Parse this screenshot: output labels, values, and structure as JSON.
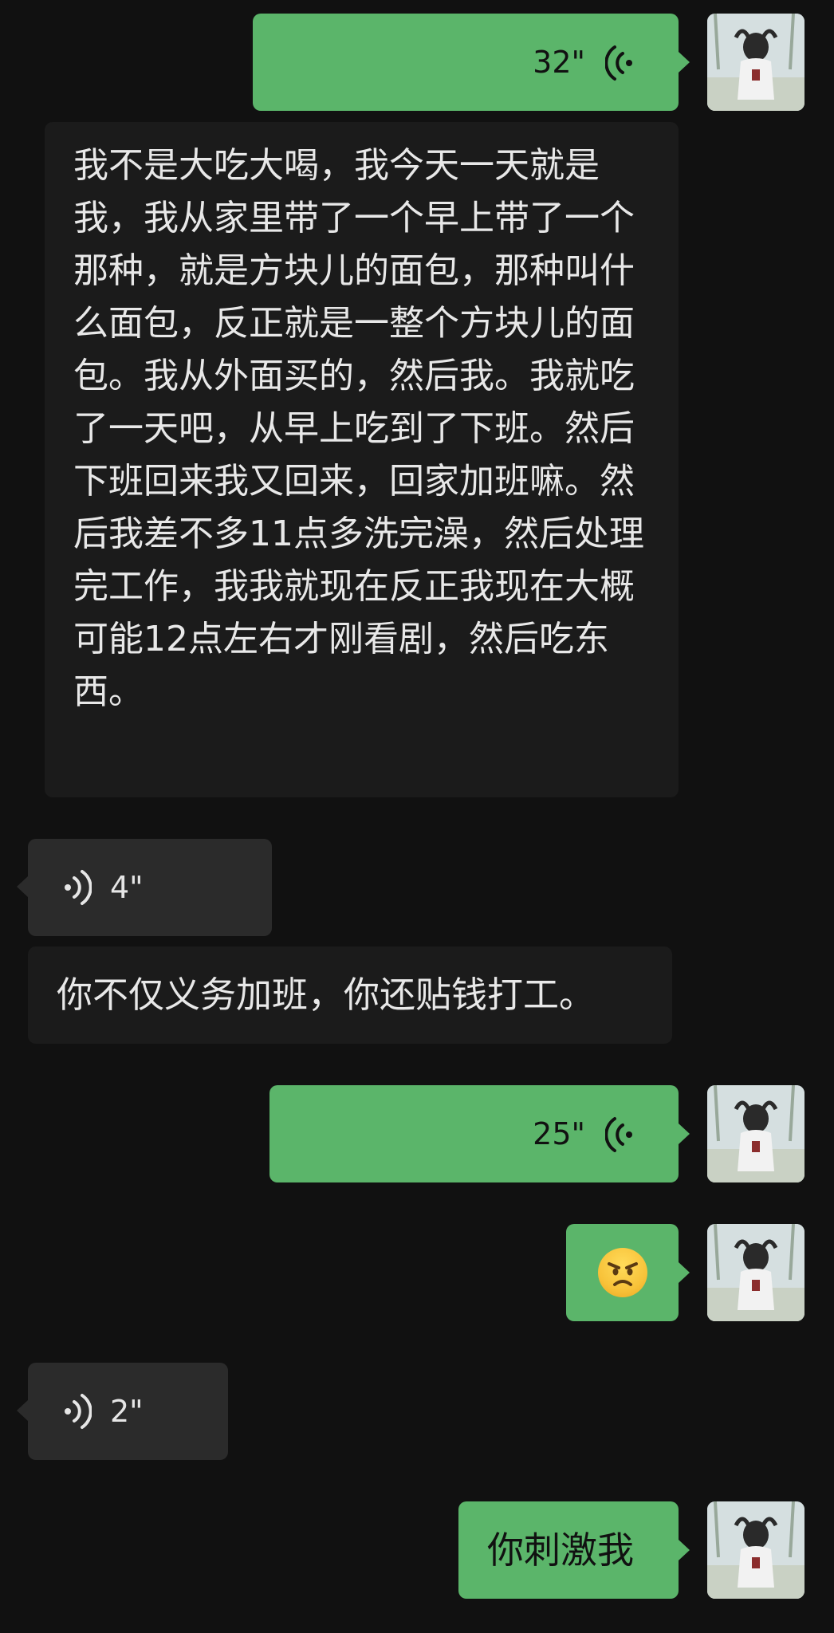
{
  "messages": [
    {
      "type": "voice",
      "direction": "out",
      "duration": "32\""
    },
    {
      "type": "text",
      "direction": "in",
      "text": "我不是大吃大喝，我今天一天就是我，我从家里带了一个早上带了一个那种，就是方块儿的面包，那种叫什么面包，反正就是一整个方块儿的面包。我从外面买的，然后我。我就吃了一天吧，从早上吃到了下班。然后下班回来我又回来，回家加班嘛。然后我差不多11点多洗完澡，然后处理完工作，我我就现在反正我现在大概可能12点左右才刚看剧，然后吃东西。"
    },
    {
      "type": "voice",
      "direction": "in",
      "duration": "4\""
    },
    {
      "type": "text",
      "direction": "in",
      "text": "你不仅义务加班，你还贴钱打工。"
    },
    {
      "type": "voice",
      "direction": "out",
      "duration": "25\""
    },
    {
      "type": "emoji",
      "direction": "out",
      "emoji": "angry-face"
    },
    {
      "type": "voice",
      "direction": "in",
      "duration": "2\""
    },
    {
      "type": "text",
      "direction": "out",
      "text": "你刺激我"
    }
  ],
  "colors": {
    "background": "#111111",
    "out_bubble": "#5bb56a",
    "in_bubble_text": "#1b1b1b",
    "in_bubble_voice": "#2b2b2b"
  },
  "icons": {
    "voice_out": "voice-wave-icon",
    "voice_in": "voice-wave-icon",
    "avatar": "user-avatar"
  }
}
